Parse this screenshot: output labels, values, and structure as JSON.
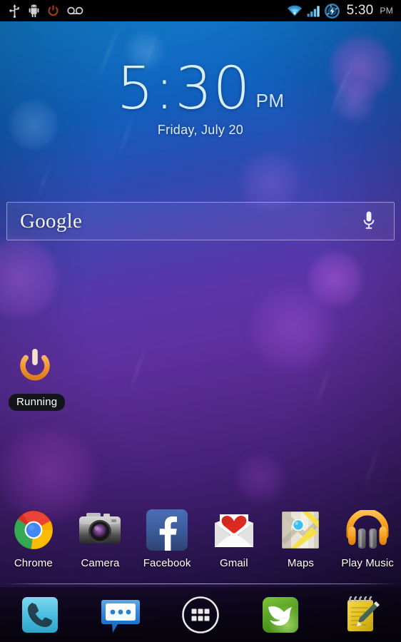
{
  "status_bar": {
    "left_icons": [
      {
        "name": "usb-icon",
        "label": "USB connected"
      },
      {
        "name": "android-debug-icon",
        "label": "USB debugging connected"
      },
      {
        "name": "power-icon",
        "label": "Power"
      },
      {
        "name": "voicemail-icon",
        "label": "Voicemail"
      }
    ],
    "right_icons": [
      {
        "name": "wifi-icon",
        "label": "Wi-Fi"
      },
      {
        "name": "cellular-signal-icon",
        "label": "Cellular signal"
      },
      {
        "name": "battery-charging-icon",
        "label": "Battery charging"
      }
    ],
    "time": "5:30",
    "ampm": "PM",
    "accent_blue": "#29b6f6",
    "power_orange": "#a03a12"
  },
  "clock_widget": {
    "time": "5:30",
    "ampm": "PM",
    "date": "Friday, July 20",
    "text_color": "#d7eefc"
  },
  "search_widget": {
    "logo_text": "Google",
    "placeholder": "Google",
    "mic_icon": "microphone-icon",
    "border_color": "#dcd2ff"
  },
  "shortcut_widget": {
    "icon": "power-icon",
    "label": "Running",
    "icon_color": "#f0962e",
    "badge_bg": "#14151a"
  },
  "apps": [
    {
      "label": "Chrome",
      "icon": "chrome-icon"
    },
    {
      "label": "Camera",
      "icon": "camera-icon"
    },
    {
      "label": "Facebook",
      "icon": "facebook-icon"
    },
    {
      "label": "Gmail",
      "icon": "gmail-icon"
    },
    {
      "label": "Maps",
      "icon": "maps-icon"
    },
    {
      "label": "Play Music",
      "icon": "play-music-icon"
    }
  ],
  "dock": [
    {
      "label": "Phone",
      "icon": "phone-icon"
    },
    {
      "label": "Messaging",
      "icon": "messaging-icon"
    },
    {
      "label": "Apps",
      "icon": "app-drawer-icon"
    },
    {
      "label": "Dolphin Browser",
      "icon": "dolphin-browser-icon"
    },
    {
      "label": "Notes",
      "icon": "notepad-icon"
    }
  ],
  "wallpaper": {
    "top_color": "#1387d6",
    "mid_color": "#5e2f9e",
    "bottom_color": "#07040f"
  }
}
